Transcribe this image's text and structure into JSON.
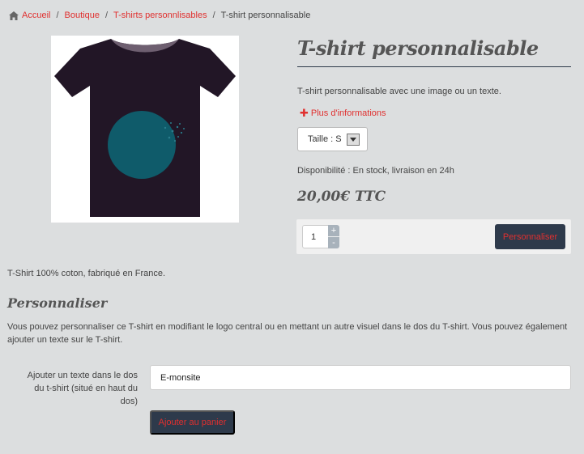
{
  "breadcrumb": {
    "home": "Accueil",
    "shop": "Boutique",
    "category": "T-shirts personnlisables",
    "current": "T-shirt personnalisable",
    "separator": "/"
  },
  "product": {
    "image_alt": "T-shirt personnalisable",
    "title": "T-shirt personnalisable",
    "short_description": "T-shirt personnalisable avec une image ou un texte.",
    "more_info": "Plus d'informations",
    "size_select": "Taille : S",
    "availability": "Disponibilité : En stock, livraison en 24h",
    "price": "20,00€ TTC",
    "quantity": "1",
    "qty_plus": "+",
    "qty_minus": "-",
    "personalize_button": "Personnaliser",
    "material": "T-Shirt 100% coton, fabriqué en France."
  },
  "personalize": {
    "section_title": "Personnaliser",
    "description": "Vous pouvez personnaliser ce T-shirt en modifiant le logo central ou en mettant un autre visuel dans le dos du T-shirt. Vous pouvez également ajouter un texte sur le T-shirt.",
    "text_label": "Ajouter un texte dans le dos du t-shirt (situé en haut du dos)",
    "text_value": "E-monsite",
    "add_to_cart": "Ajouter au panier"
  },
  "colors": {
    "accent": "#e0302f",
    "dark": "#2e3a4b",
    "background": "#dcdedf",
    "shirt": "#221626",
    "logo": "#0f5b6a"
  },
  "icons": {
    "home": "home-icon",
    "plus": "plus-icon",
    "dropdown": "chevron-down-icon"
  }
}
